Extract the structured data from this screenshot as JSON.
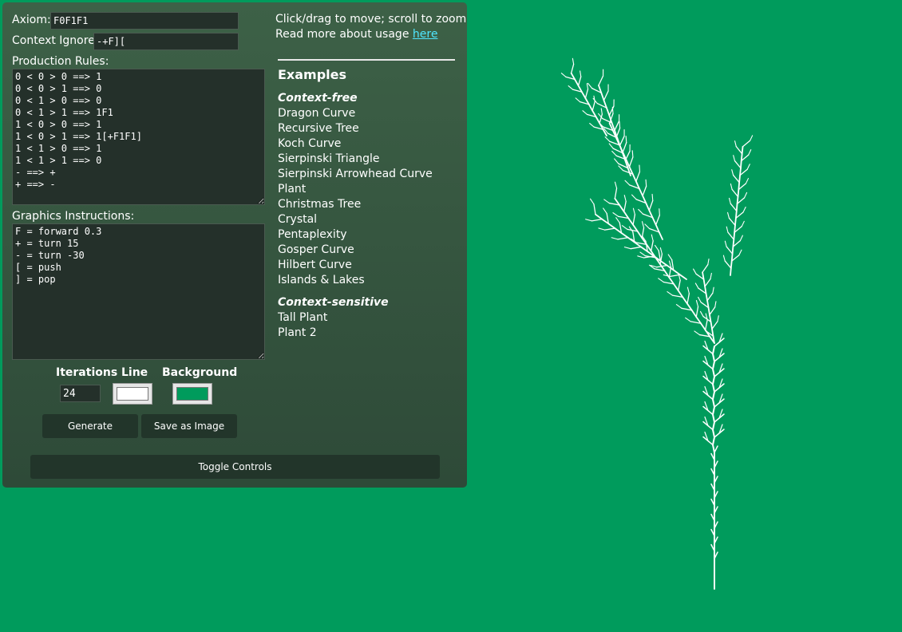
{
  "axiom": {
    "label": "Axiom:",
    "value": "F0F1F1"
  },
  "context_ignore": {
    "label": "Context Ignore:",
    "value": "-+F]["
  },
  "production_rules": {
    "label": "Production Rules:",
    "value": "0 < 0 > 0 ==> 1\n0 < 0 > 1 ==> 0\n0 < 1 > 0 ==> 0\n0 < 1 > 1 ==> 1F1\n1 < 0 > 0 ==> 1\n1 < 0 > 1 ==> 1[+F1F1]\n1 < 1 > 0 ==> 1\n1 < 1 > 1 ==> 0\n- ==> +\n+ ==> -"
  },
  "graphics_instructions": {
    "label": "Graphics Instructions:",
    "value": "F = forward 0.3\n+ = turn 15\n- = turn -30\n[ = push\n] = pop"
  },
  "iterations": {
    "label": "Iterations",
    "value": "24"
  },
  "line": {
    "label": "Line",
    "color": "#ffffff"
  },
  "background": {
    "label": "Background",
    "color": "#009b5c"
  },
  "buttons": {
    "generate": "Generate",
    "save": "Save as Image",
    "toggle": "Toggle Controls"
  },
  "help": {
    "line1": "Click/drag to move; scroll to zoom",
    "line2": "Read more about usage ",
    "link": "here"
  },
  "examples": {
    "title": "Examples",
    "context_free_label": "Context-free",
    "context_free": [
      "Dragon Curve",
      "Recursive Tree",
      "Koch Curve",
      "Sierpinski Triangle",
      "Sierpinski Arrowhead Curve",
      "Plant",
      "Christmas Tree",
      "Crystal",
      "Pentaplexity",
      "Gosper Curve",
      "Hilbert Curve",
      "Islands & Lakes"
    ],
    "context_sensitive_label": "Context-sensitive",
    "context_sensitive": [
      "Tall Plant",
      "Plant 2"
    ]
  },
  "icons": {
    "resize_handle": "resize-grip-icon"
  }
}
